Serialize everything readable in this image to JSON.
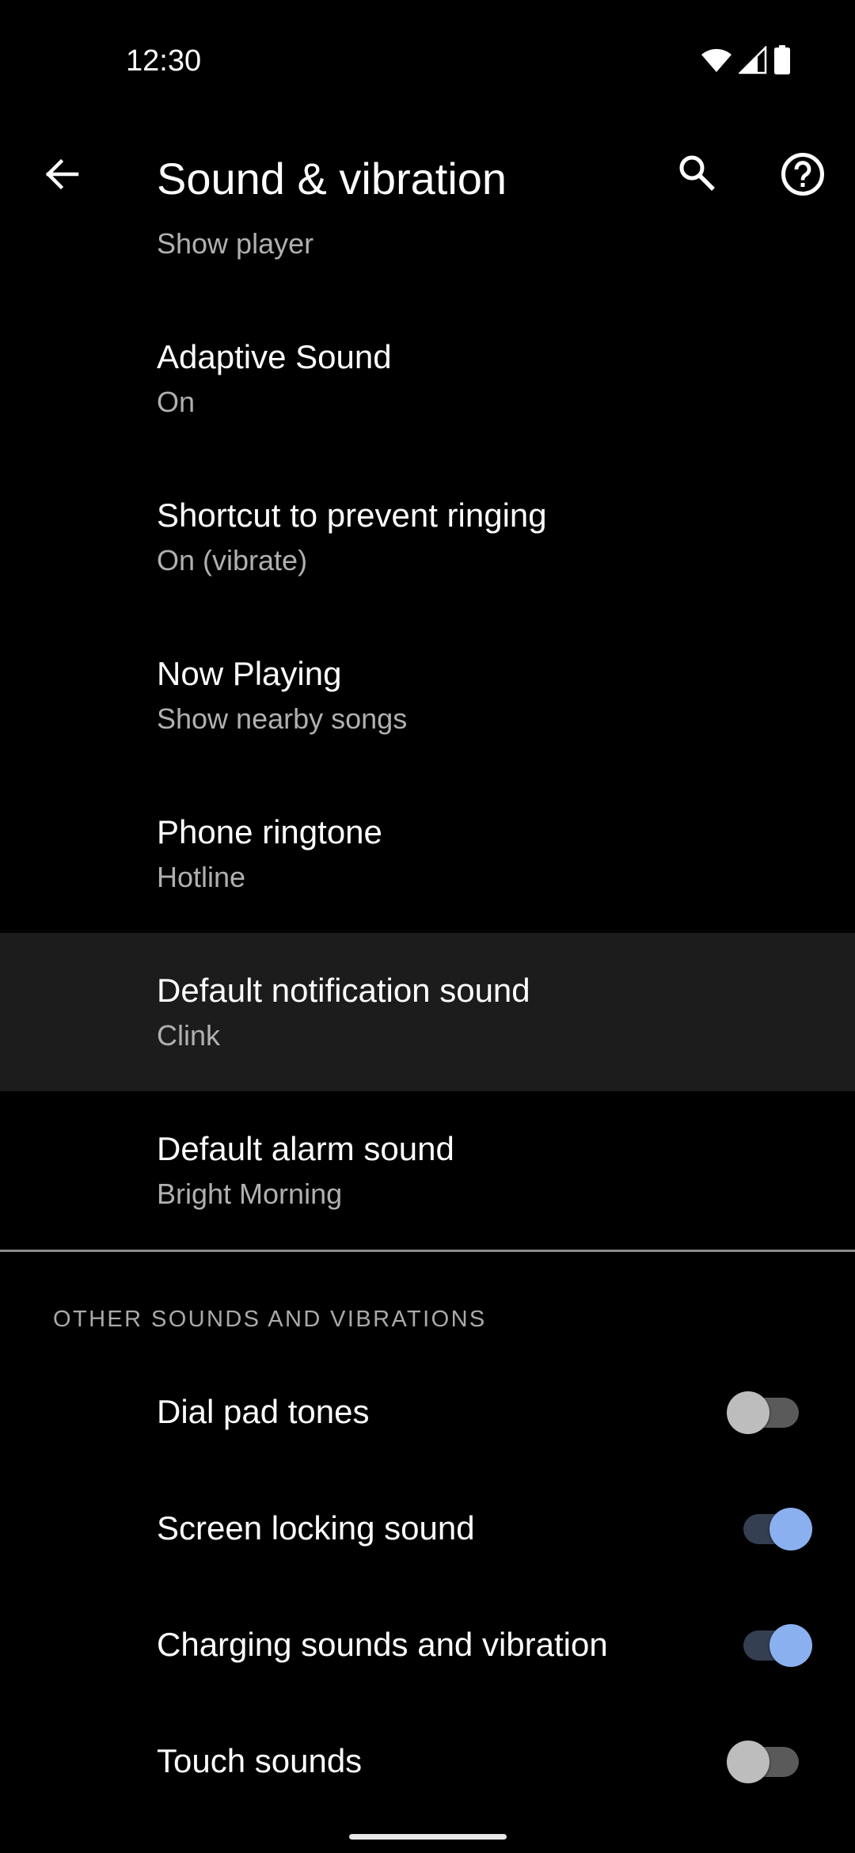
{
  "status_bar": {
    "time": "12:30",
    "icons": [
      "wifi-full-icon",
      "cell-signal-icon",
      "battery-full-icon"
    ]
  },
  "app_bar": {
    "back_icon": "arrow-back-icon",
    "title": "Sound & vibration",
    "search_icon": "search-icon",
    "help_icon": "help-circle-icon"
  },
  "list": {
    "clipped_summary": "Show player",
    "items": [
      {
        "title": "Adaptive Sound",
        "summary": "On",
        "pressed": false
      },
      {
        "title": "Shortcut to prevent ringing",
        "summary": "On (vibrate)",
        "pressed": false
      },
      {
        "title": "Now Playing",
        "summary": "Show nearby songs",
        "pressed": false
      },
      {
        "title": "Phone ringtone",
        "summary": "Hotline",
        "pressed": false
      },
      {
        "title": "Default notification sound",
        "summary": "Clink",
        "pressed": true
      },
      {
        "title": "Default alarm sound",
        "summary": "Bright Morning",
        "pressed": false
      }
    ]
  },
  "other_section": {
    "header": "OTHER SOUNDS AND VIBRATIONS",
    "toggles": [
      {
        "title": "Dial pad tones",
        "checked": false
      },
      {
        "title": "Screen locking sound",
        "checked": true
      },
      {
        "title": "Charging sounds and vibration",
        "checked": true
      },
      {
        "title": "Touch sounds",
        "checked": false
      }
    ]
  },
  "colors": {
    "background": "#000000",
    "pressed_row": "#1c1c1c",
    "primary_text": "#ffffff",
    "secondary_text": "#b0b0b0",
    "divider": "#8a8a8a",
    "switch_on_thumb": "#8ab0f0",
    "switch_on_track": "#353f52",
    "switch_off_thumb": "#bdbdbd",
    "switch_off_track": "#5a5a5a"
  }
}
